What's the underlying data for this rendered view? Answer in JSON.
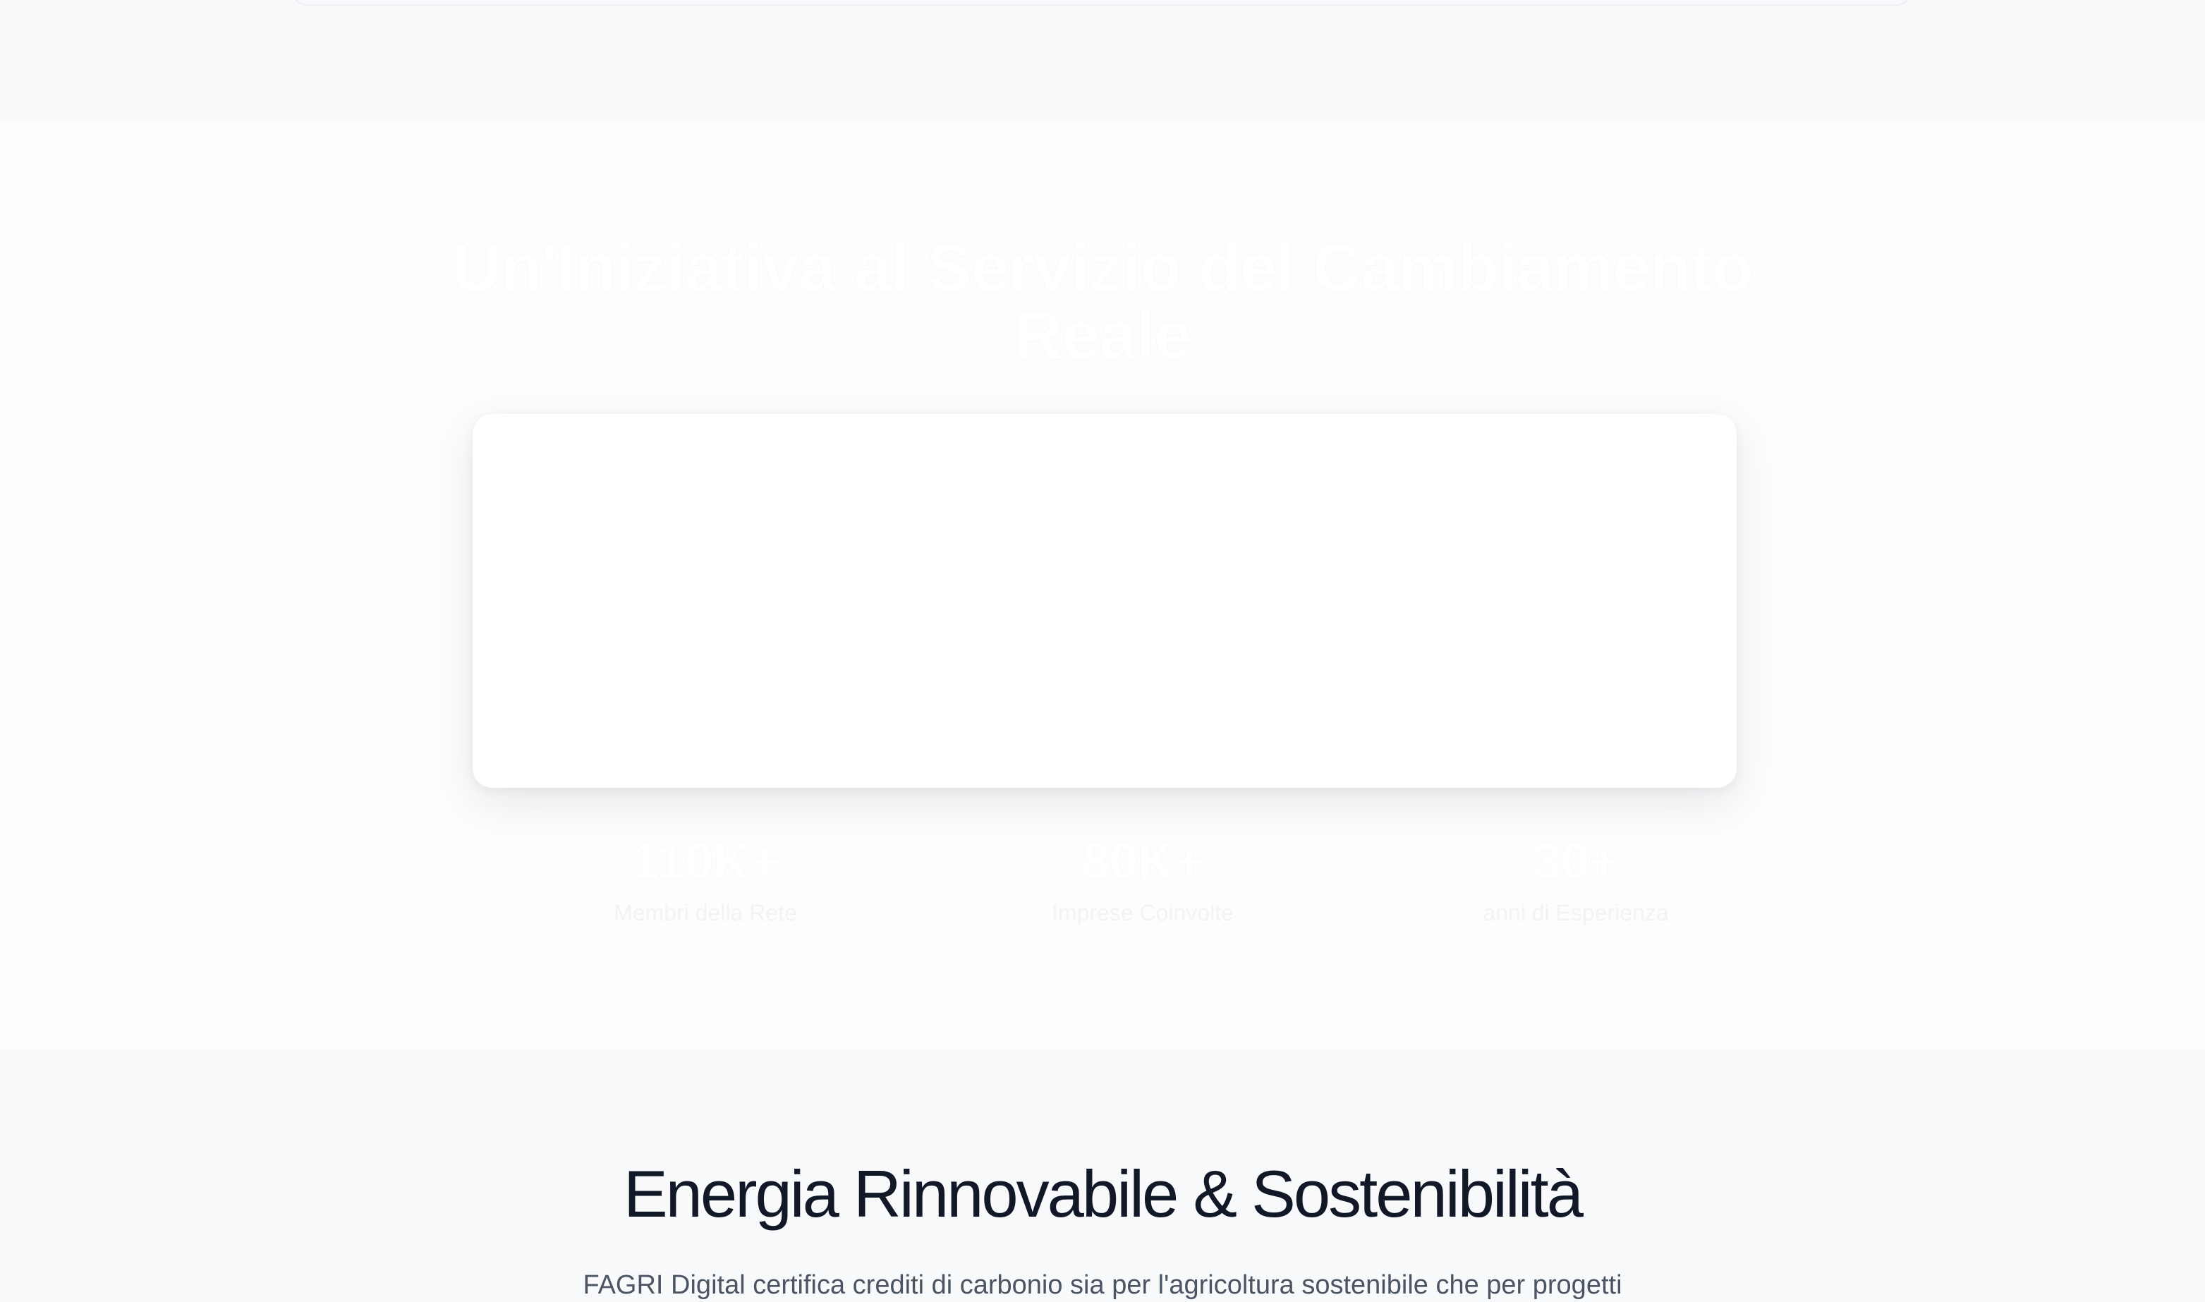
{
  "initiative": {
    "title_line1": "Un'Iniziativa al Servizio del Cambiamento",
    "title_line2": "Reale",
    "stats": [
      {
        "value": "110K+",
        "label": "Membri della Rete"
      },
      {
        "value": "80K+",
        "label": "Imprese Coinvolte"
      },
      {
        "value": "30+",
        "label": "anni di Esperienza"
      }
    ]
  },
  "renewable": {
    "title": "Energia Rinnovabile & Sostenibilità",
    "description": "FAGRI Digital certifica crediti di carbonio sia per l'agricoltura sostenibile che per progetti"
  },
  "colors": {
    "page_background": "#f8f9fb",
    "section_background": "#fdfdfe",
    "heading_dark": "#111827",
    "body_text": "#4b5563",
    "card_background": "#ffffff"
  }
}
